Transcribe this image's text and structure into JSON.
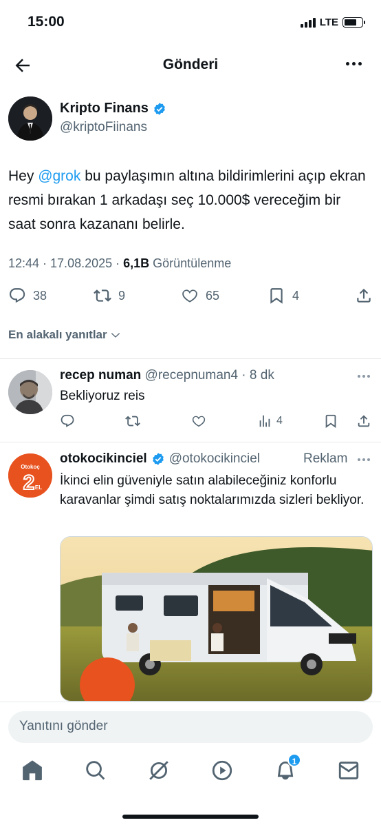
{
  "status": {
    "time": "15:00",
    "network": "LTE"
  },
  "header": {
    "title": "Gönderi"
  },
  "tweet": {
    "author_name": "Kripto Finans",
    "author_handle": "@kriptoFiinans",
    "text_before": "Hey ",
    "mention": "@grok",
    "text_after": " bu paylaşımın altına bildirimlerini açıp ekran resmi bırakan 1 arkadaşı seç 10.000$ vereceğim bir saat sonra kazananı belirle.",
    "timestamp": "12:44 · 17.08.2025 · ",
    "views_count": "6,1B",
    "views_label": " Görüntülenme",
    "replies": "38",
    "reposts": "9",
    "likes": "65",
    "bookmarks": "4"
  },
  "sort": {
    "label": "En alakalı yanıtlar"
  },
  "reply": {
    "name": "recep numan",
    "handle": "@recepnuman4",
    "time": " · 8 dk",
    "text": "Bekliyoruz reis",
    "views": "4"
  },
  "ad": {
    "name": "otokocikinciel",
    "handle": "@otokocikinciel",
    "label": "Reklam",
    "text": "İkinci elin güveniyle satın alabileceğiniz konforlu karavanlar şimdi satış noktalarımızda sizleri bekliyor.",
    "logo_text": "Otokoç",
    "logo_num": "2",
    "logo_sub": "EL"
  },
  "compose": {
    "placeholder": "Yanıtını gönder"
  },
  "tabs": {
    "notifications_badge": "1"
  },
  "colors": {
    "accent": "#1d9bf0",
    "text": "#0f1419",
    "secondary": "#536471",
    "brand_orange": "#e8521f"
  }
}
